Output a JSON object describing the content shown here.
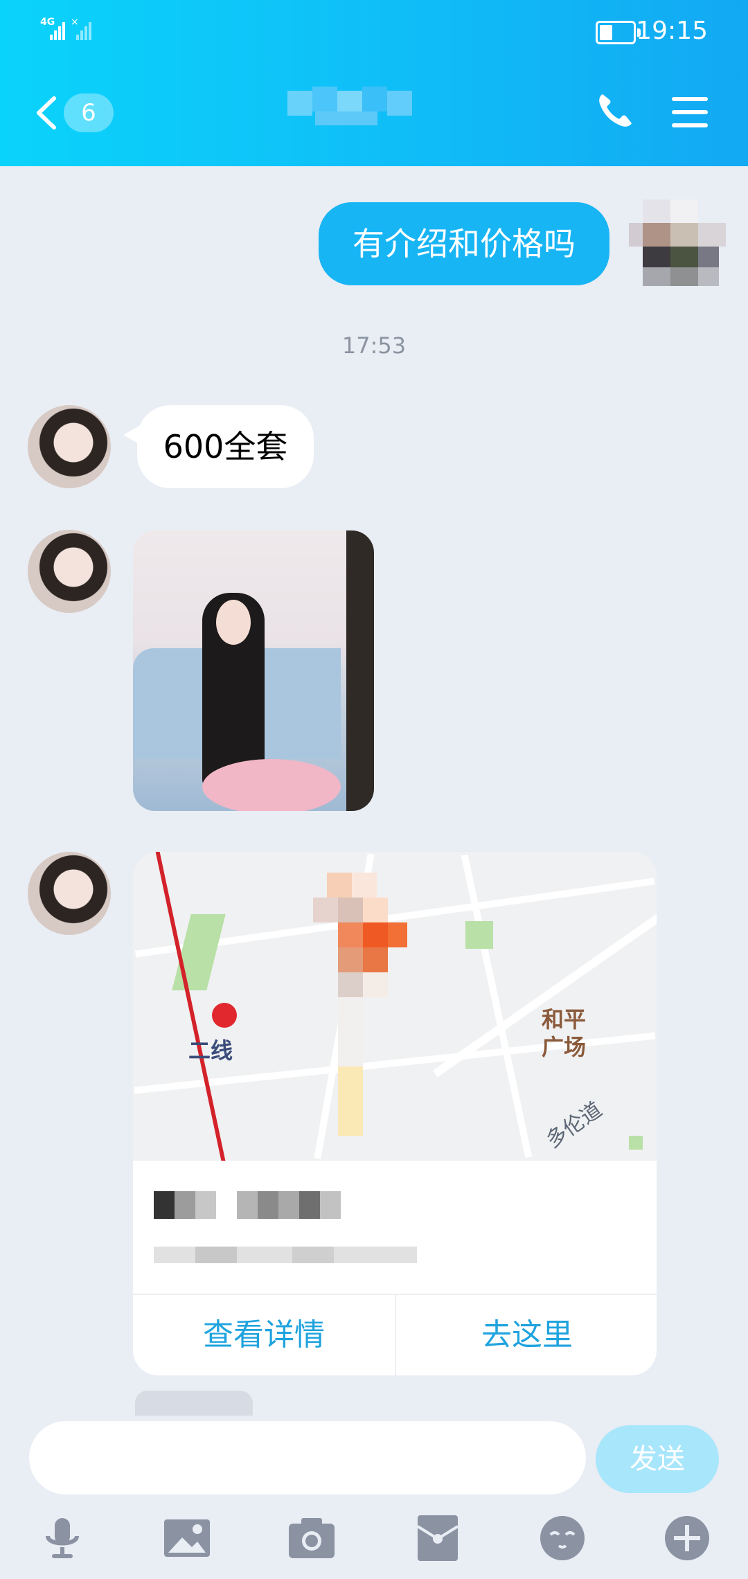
{
  "status_bar": {
    "network": "4G",
    "time": "19:15"
  },
  "header": {
    "unread_count": "6",
    "colors": {
      "background": "#10bdf7"
    }
  },
  "messages": {
    "outgoing_1": "有介绍和价格吗",
    "timestamp": "17:53",
    "incoming_1": "600全套"
  },
  "location_card": {
    "map_labels": {
      "metro": "二线",
      "plaza": "和平",
      "plaza_2": "广场",
      "road": "多伦道"
    },
    "details_button": "查看详情",
    "goto_button": "去这里"
  },
  "input_bar": {
    "send_label": "发送"
  },
  "toolbar": {
    "icons": [
      "microphone-icon",
      "image-icon",
      "camera-icon",
      "red-packet-icon",
      "emoji-icon",
      "plus-icon"
    ]
  },
  "colors": {
    "accent": "#18b5f5",
    "link": "#1fa3de",
    "chat_background": "#e9edf4"
  }
}
